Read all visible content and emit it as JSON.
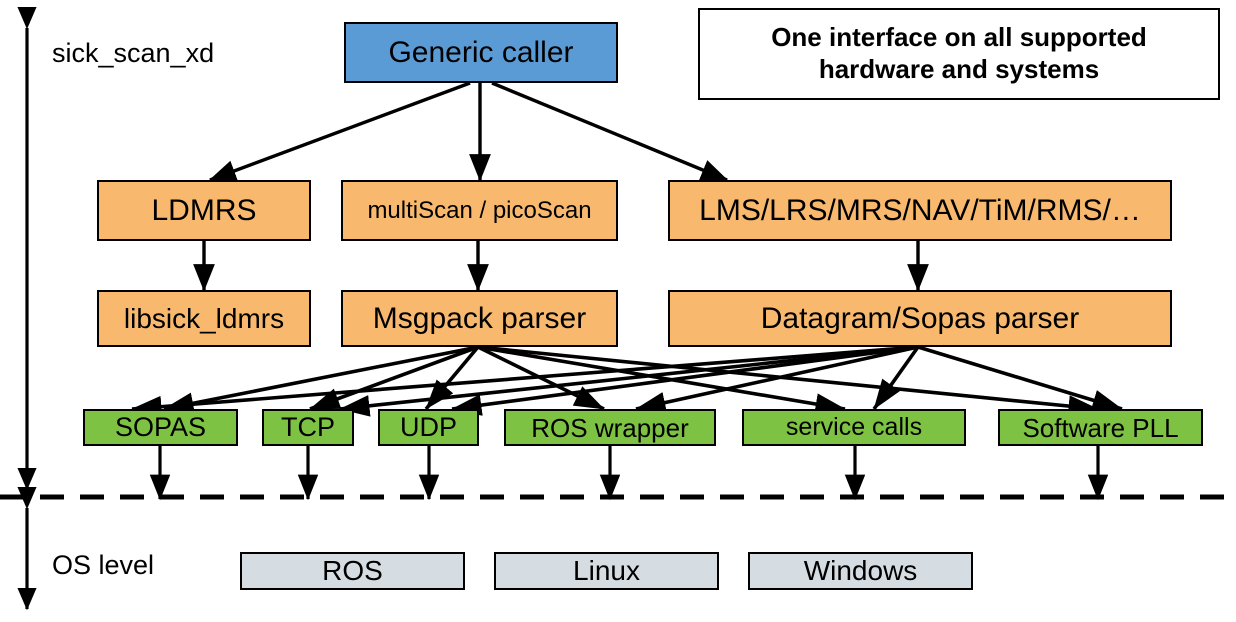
{
  "diagram": {
    "title_note": {
      "line1": "One interface on all supported",
      "line2": "hardware and systems"
    },
    "axis_labels": {
      "upper": "sick_scan_xd",
      "lower": "OS level"
    },
    "layers": {
      "caller": [
        {
          "id": "generic-caller",
          "label": "Generic caller",
          "color": "#5B9BD5"
        }
      ],
      "devices": [
        {
          "id": "ldmrs",
          "label": "LDMRS",
          "color": "#F8B96E"
        },
        {
          "id": "multiscan-picoscan",
          "label": "multiScan / picoScan",
          "color": "#F8B96E"
        },
        {
          "id": "lms-family",
          "label": "LMS/LRS/MRS/NAV/TiM/RMS/…",
          "color": "#F8B96E"
        }
      ],
      "parsers": [
        {
          "id": "libsick-ldmrs",
          "label": "libsick_ldmrs",
          "color": "#F8B96E"
        },
        {
          "id": "msgpack-parser",
          "label": "Msgpack parser",
          "color": "#F8B96E"
        },
        {
          "id": "datagram-sopas-parser",
          "label": "Datagram/Sopas parser",
          "color": "#F8B96E"
        }
      ],
      "interfaces": [
        {
          "id": "sopas",
          "label": "SOPAS",
          "color": "#7DC242"
        },
        {
          "id": "tcp",
          "label": "TCP",
          "color": "#7DC242"
        },
        {
          "id": "udp",
          "label": "UDP",
          "color": "#7DC242"
        },
        {
          "id": "ros-wrapper",
          "label": "ROS wrapper",
          "color": "#7DC242"
        },
        {
          "id": "service-calls",
          "label": "service calls",
          "color": "#7DC242"
        },
        {
          "id": "software-pll",
          "label": "Software PLL",
          "color": "#7DC242"
        }
      ],
      "os": [
        {
          "id": "ros",
          "label": "ROS",
          "color": "#D6DDE2"
        },
        {
          "id": "linux",
          "label": "Linux",
          "color": "#D6DDE2"
        },
        {
          "id": "windows",
          "label": "Windows",
          "color": "#D6DDE2"
        }
      ]
    },
    "colors": {
      "caller": "#5B9BD5",
      "device": "#F8B96E",
      "parser": "#F8B96E",
      "interface": "#7DC242",
      "os": "#D6DDE2",
      "line": "#000000",
      "background": "#FFFFFF"
    }
  }
}
